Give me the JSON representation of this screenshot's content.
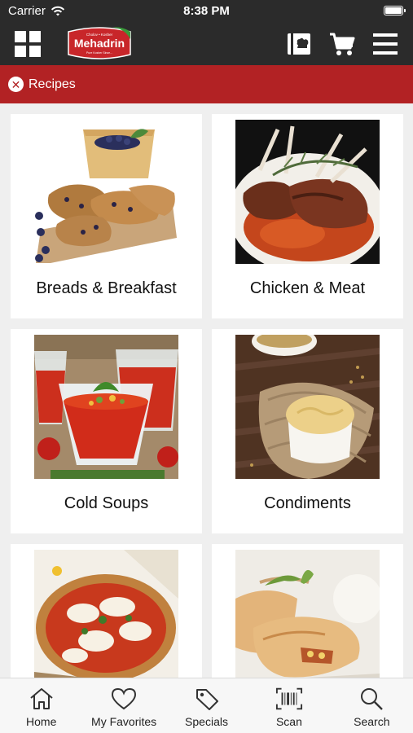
{
  "status_bar": {
    "carrier": "Carrier",
    "time": "8:38 PM"
  },
  "header": {
    "logo": {
      "text": "Mehadrin",
      "tagline_top": "Cholov • Kosher",
      "tagline_bottom": "Pure Kosher Since..."
    },
    "icons": [
      "grid-icon",
      "recipe-book-icon",
      "cart-icon",
      "menu-icon"
    ]
  },
  "breadcrumb": {
    "label": "Recipes",
    "close_icon": "close-circle-icon"
  },
  "categories": [
    {
      "name": "Breads & Breakfast",
      "image": "muffin-scones-photo"
    },
    {
      "name": "Chicken & Meat",
      "image": "lamb-rack-photo"
    },
    {
      "name": "Cold Soups",
      "image": "gazpacho-photo"
    },
    {
      "name": "Condiments",
      "image": "mustard-bowl-photo"
    },
    {
      "name": "",
      "image": "pizza-photo"
    },
    {
      "name": "",
      "image": "strudel-photo"
    }
  ],
  "tab_bar": [
    {
      "label": "Home",
      "icon": "home-icon"
    },
    {
      "label": "My Favorites",
      "icon": "heart-icon"
    },
    {
      "label": "Specials",
      "icon": "tag-icon"
    },
    {
      "label": "Scan",
      "icon": "barcode-scan-icon"
    },
    {
      "label": "Search",
      "icon": "search-icon"
    }
  ],
  "colors": {
    "header_bg": "#2b2b2b",
    "accent_red": "#b22224",
    "tab_bg": "#f7f7f7",
    "page_bg": "#efefef"
  }
}
